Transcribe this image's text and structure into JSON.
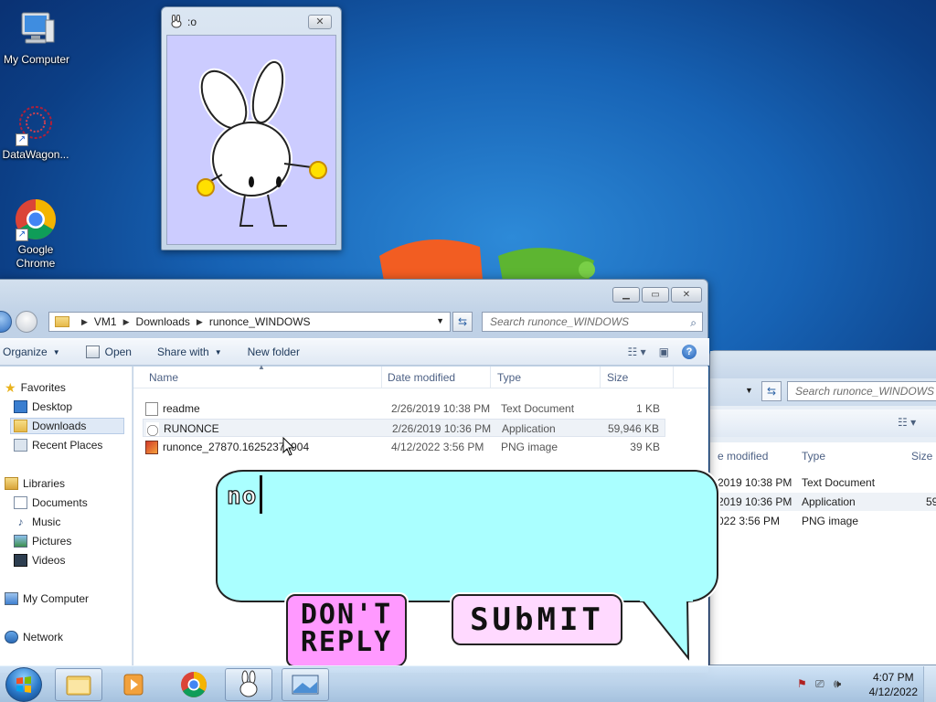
{
  "desktop": {
    "icons": [
      {
        "label": "My Computer"
      },
      {
        "label": "DataWagon..."
      },
      {
        "label": "Google Chrome"
      }
    ]
  },
  "bunny_window": {
    "title": ":o"
  },
  "explorer": {
    "breadcrumb": [
      "VM1",
      "Downloads",
      "runonce_WINDOWS"
    ],
    "search_placeholder": "Search runonce_WINDOWS",
    "toolbar": {
      "organize": "Organize",
      "open": "Open",
      "share_with": "Share with",
      "new_folder": "New folder"
    },
    "nav": {
      "favorites": "Favorites",
      "desktop": "Desktop",
      "downloads": "Downloads",
      "recent_places": "Recent Places",
      "libraries": "Libraries",
      "documents": "Documents",
      "music": "Music",
      "pictures": "Pictures",
      "videos": "Videos",
      "my_computer": "My Computer",
      "network": "Network"
    },
    "columns": {
      "name": "Name",
      "date": "Date modified",
      "type": "Type",
      "size": "Size"
    },
    "files": [
      {
        "name": "readme",
        "date": "2/26/2019 10:38 PM",
        "type": "Text Document",
        "size": "1 KB"
      },
      {
        "name": "RUNONCE",
        "date": "2/26/2019 10:36 PM",
        "type": "Application",
        "size": "59,946 KB"
      },
      {
        "name": "runonce_27870.16252373904",
        "date": "4/12/2022 3:56 PM",
        "type": "PNG image",
        "size": "39 KB"
      }
    ]
  },
  "back_window": {
    "search_placeholder": "Search runonce_WINDOWS",
    "columns": {
      "date": "e modified",
      "type": "Type",
      "size": "Size"
    },
    "files": [
      {
        "date": "2019 10:38 PM",
        "type": "Text Document",
        "size": ""
      },
      {
        "date": "2019 10:36 PM",
        "type": "Application",
        "size": "59"
      },
      {
        "date": "022 3:56 PM",
        "type": "PNG image",
        "size": ""
      }
    ]
  },
  "dialog": {
    "input_value": "no",
    "dont_reply_line1": "DON'T",
    "dont_reply_line2": "REPLY",
    "submit_label": "SUbMIT",
    "bubble_color": "#aaffff",
    "dont_color": "#ff99ff",
    "submit_color": "#ffd9ff"
  },
  "taskbar": {
    "time": "4:07 PM",
    "date": "4/12/2022"
  }
}
